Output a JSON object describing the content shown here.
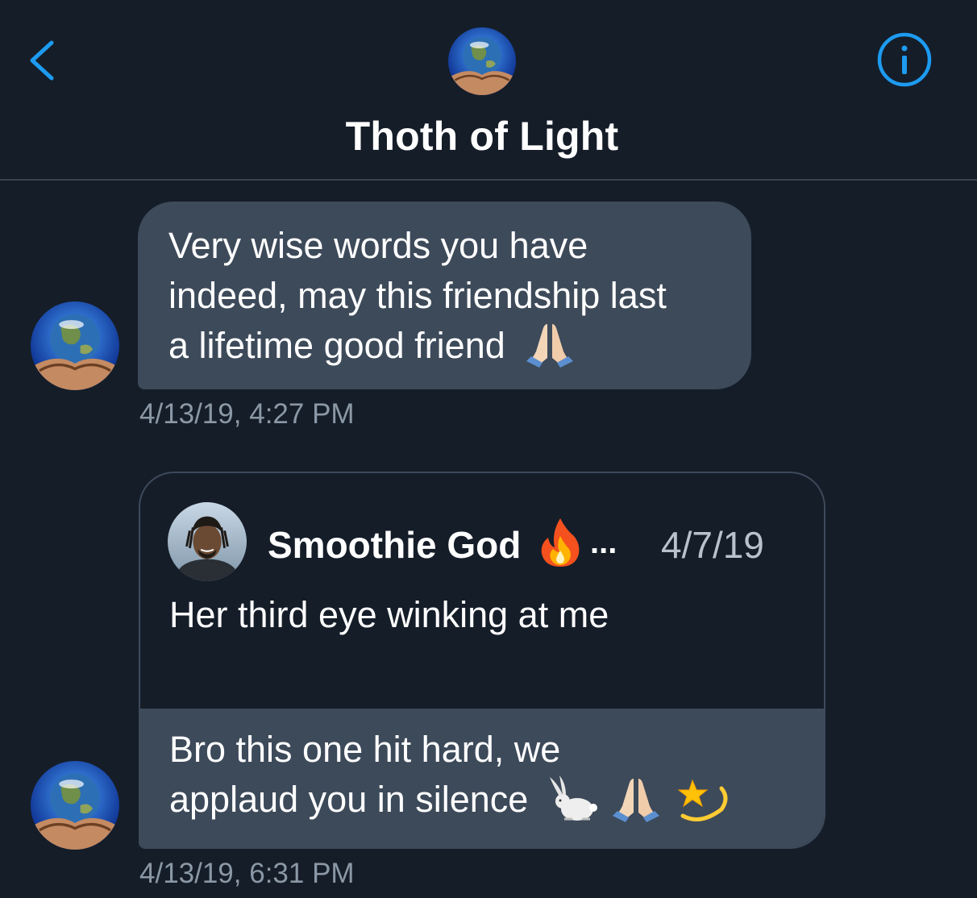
{
  "header": {
    "title": "Thoth of Light"
  },
  "colors": {
    "accent": "#1d9bf0",
    "bubble": "#3d4a5a",
    "background": "#151d29",
    "muted": "#8b98a5"
  },
  "icons": {
    "back": "chevron-left-icon",
    "info": "info-circle-icon",
    "pray": "folded-hands-emoji",
    "fire": "fire-emoji",
    "rabbit": "rabbit-emoji",
    "dizzy": "dizzy-star-emoji"
  },
  "messages": [
    {
      "lines": [
        "Very wise words you have",
        "indeed, may this friendship last",
        "a lifetime good friend"
      ],
      "timestamp": "4/13/19, 4:27 PM"
    },
    {
      "quoted_tweet": {
        "author": "Smoothie God",
        "ellipsis": "...",
        "date": "4/7/19",
        "text": "Her third eye winking at me"
      },
      "lines": [
        "Bro this one hit hard, we",
        "applaud you in silence"
      ],
      "timestamp": "4/13/19, 6:31 PM"
    }
  ]
}
